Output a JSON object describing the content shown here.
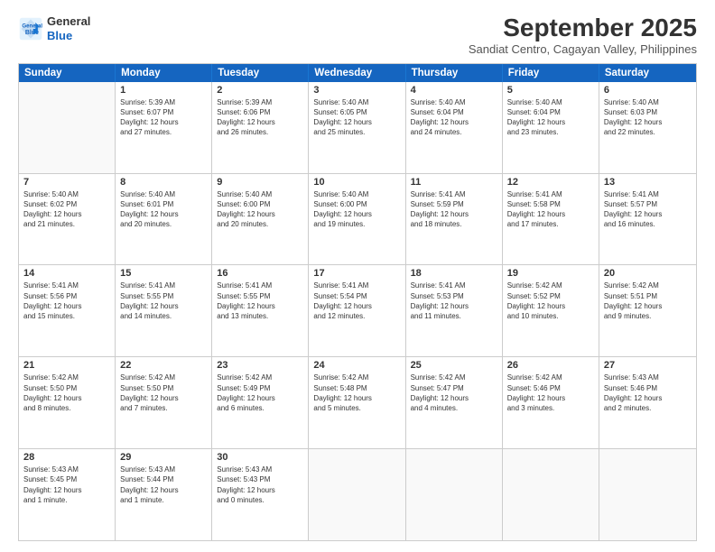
{
  "logo": {
    "line1": "General",
    "line2": "Blue"
  },
  "title": "September 2025",
  "subtitle": "Sandiat Centro, Cagayan Valley, Philippines",
  "headers": [
    "Sunday",
    "Monday",
    "Tuesday",
    "Wednesday",
    "Thursday",
    "Friday",
    "Saturday"
  ],
  "rows": [
    [
      {
        "day": "",
        "info": ""
      },
      {
        "day": "1",
        "info": "Sunrise: 5:39 AM\nSunset: 6:07 PM\nDaylight: 12 hours\nand 27 minutes."
      },
      {
        "day": "2",
        "info": "Sunrise: 5:39 AM\nSunset: 6:06 PM\nDaylight: 12 hours\nand 26 minutes."
      },
      {
        "day": "3",
        "info": "Sunrise: 5:40 AM\nSunset: 6:05 PM\nDaylight: 12 hours\nand 25 minutes."
      },
      {
        "day": "4",
        "info": "Sunrise: 5:40 AM\nSunset: 6:04 PM\nDaylight: 12 hours\nand 24 minutes."
      },
      {
        "day": "5",
        "info": "Sunrise: 5:40 AM\nSunset: 6:04 PM\nDaylight: 12 hours\nand 23 minutes."
      },
      {
        "day": "6",
        "info": "Sunrise: 5:40 AM\nSunset: 6:03 PM\nDaylight: 12 hours\nand 22 minutes."
      }
    ],
    [
      {
        "day": "7",
        "info": "Sunrise: 5:40 AM\nSunset: 6:02 PM\nDaylight: 12 hours\nand 21 minutes."
      },
      {
        "day": "8",
        "info": "Sunrise: 5:40 AM\nSunset: 6:01 PM\nDaylight: 12 hours\nand 20 minutes."
      },
      {
        "day": "9",
        "info": "Sunrise: 5:40 AM\nSunset: 6:00 PM\nDaylight: 12 hours\nand 20 minutes."
      },
      {
        "day": "10",
        "info": "Sunrise: 5:40 AM\nSunset: 6:00 PM\nDaylight: 12 hours\nand 19 minutes."
      },
      {
        "day": "11",
        "info": "Sunrise: 5:41 AM\nSunset: 5:59 PM\nDaylight: 12 hours\nand 18 minutes."
      },
      {
        "day": "12",
        "info": "Sunrise: 5:41 AM\nSunset: 5:58 PM\nDaylight: 12 hours\nand 17 minutes."
      },
      {
        "day": "13",
        "info": "Sunrise: 5:41 AM\nSunset: 5:57 PM\nDaylight: 12 hours\nand 16 minutes."
      }
    ],
    [
      {
        "day": "14",
        "info": "Sunrise: 5:41 AM\nSunset: 5:56 PM\nDaylight: 12 hours\nand 15 minutes."
      },
      {
        "day": "15",
        "info": "Sunrise: 5:41 AM\nSunset: 5:55 PM\nDaylight: 12 hours\nand 14 minutes."
      },
      {
        "day": "16",
        "info": "Sunrise: 5:41 AM\nSunset: 5:55 PM\nDaylight: 12 hours\nand 13 minutes."
      },
      {
        "day": "17",
        "info": "Sunrise: 5:41 AM\nSunset: 5:54 PM\nDaylight: 12 hours\nand 12 minutes."
      },
      {
        "day": "18",
        "info": "Sunrise: 5:41 AM\nSunset: 5:53 PM\nDaylight: 12 hours\nand 11 minutes."
      },
      {
        "day": "19",
        "info": "Sunrise: 5:42 AM\nSunset: 5:52 PM\nDaylight: 12 hours\nand 10 minutes."
      },
      {
        "day": "20",
        "info": "Sunrise: 5:42 AM\nSunset: 5:51 PM\nDaylight: 12 hours\nand 9 minutes."
      }
    ],
    [
      {
        "day": "21",
        "info": "Sunrise: 5:42 AM\nSunset: 5:50 PM\nDaylight: 12 hours\nand 8 minutes."
      },
      {
        "day": "22",
        "info": "Sunrise: 5:42 AM\nSunset: 5:50 PM\nDaylight: 12 hours\nand 7 minutes."
      },
      {
        "day": "23",
        "info": "Sunrise: 5:42 AM\nSunset: 5:49 PM\nDaylight: 12 hours\nand 6 minutes."
      },
      {
        "day": "24",
        "info": "Sunrise: 5:42 AM\nSunset: 5:48 PM\nDaylight: 12 hours\nand 5 minutes."
      },
      {
        "day": "25",
        "info": "Sunrise: 5:42 AM\nSunset: 5:47 PM\nDaylight: 12 hours\nand 4 minutes."
      },
      {
        "day": "26",
        "info": "Sunrise: 5:42 AM\nSunset: 5:46 PM\nDaylight: 12 hours\nand 3 minutes."
      },
      {
        "day": "27",
        "info": "Sunrise: 5:43 AM\nSunset: 5:46 PM\nDaylight: 12 hours\nand 2 minutes."
      }
    ],
    [
      {
        "day": "28",
        "info": "Sunrise: 5:43 AM\nSunset: 5:45 PM\nDaylight: 12 hours\nand 1 minute."
      },
      {
        "day": "29",
        "info": "Sunrise: 5:43 AM\nSunset: 5:44 PM\nDaylight: 12 hours\nand 1 minute."
      },
      {
        "day": "30",
        "info": "Sunrise: 5:43 AM\nSunset: 5:43 PM\nDaylight: 12 hours\nand 0 minutes."
      },
      {
        "day": "",
        "info": ""
      },
      {
        "day": "",
        "info": ""
      },
      {
        "day": "",
        "info": ""
      },
      {
        "day": "",
        "info": ""
      }
    ]
  ]
}
